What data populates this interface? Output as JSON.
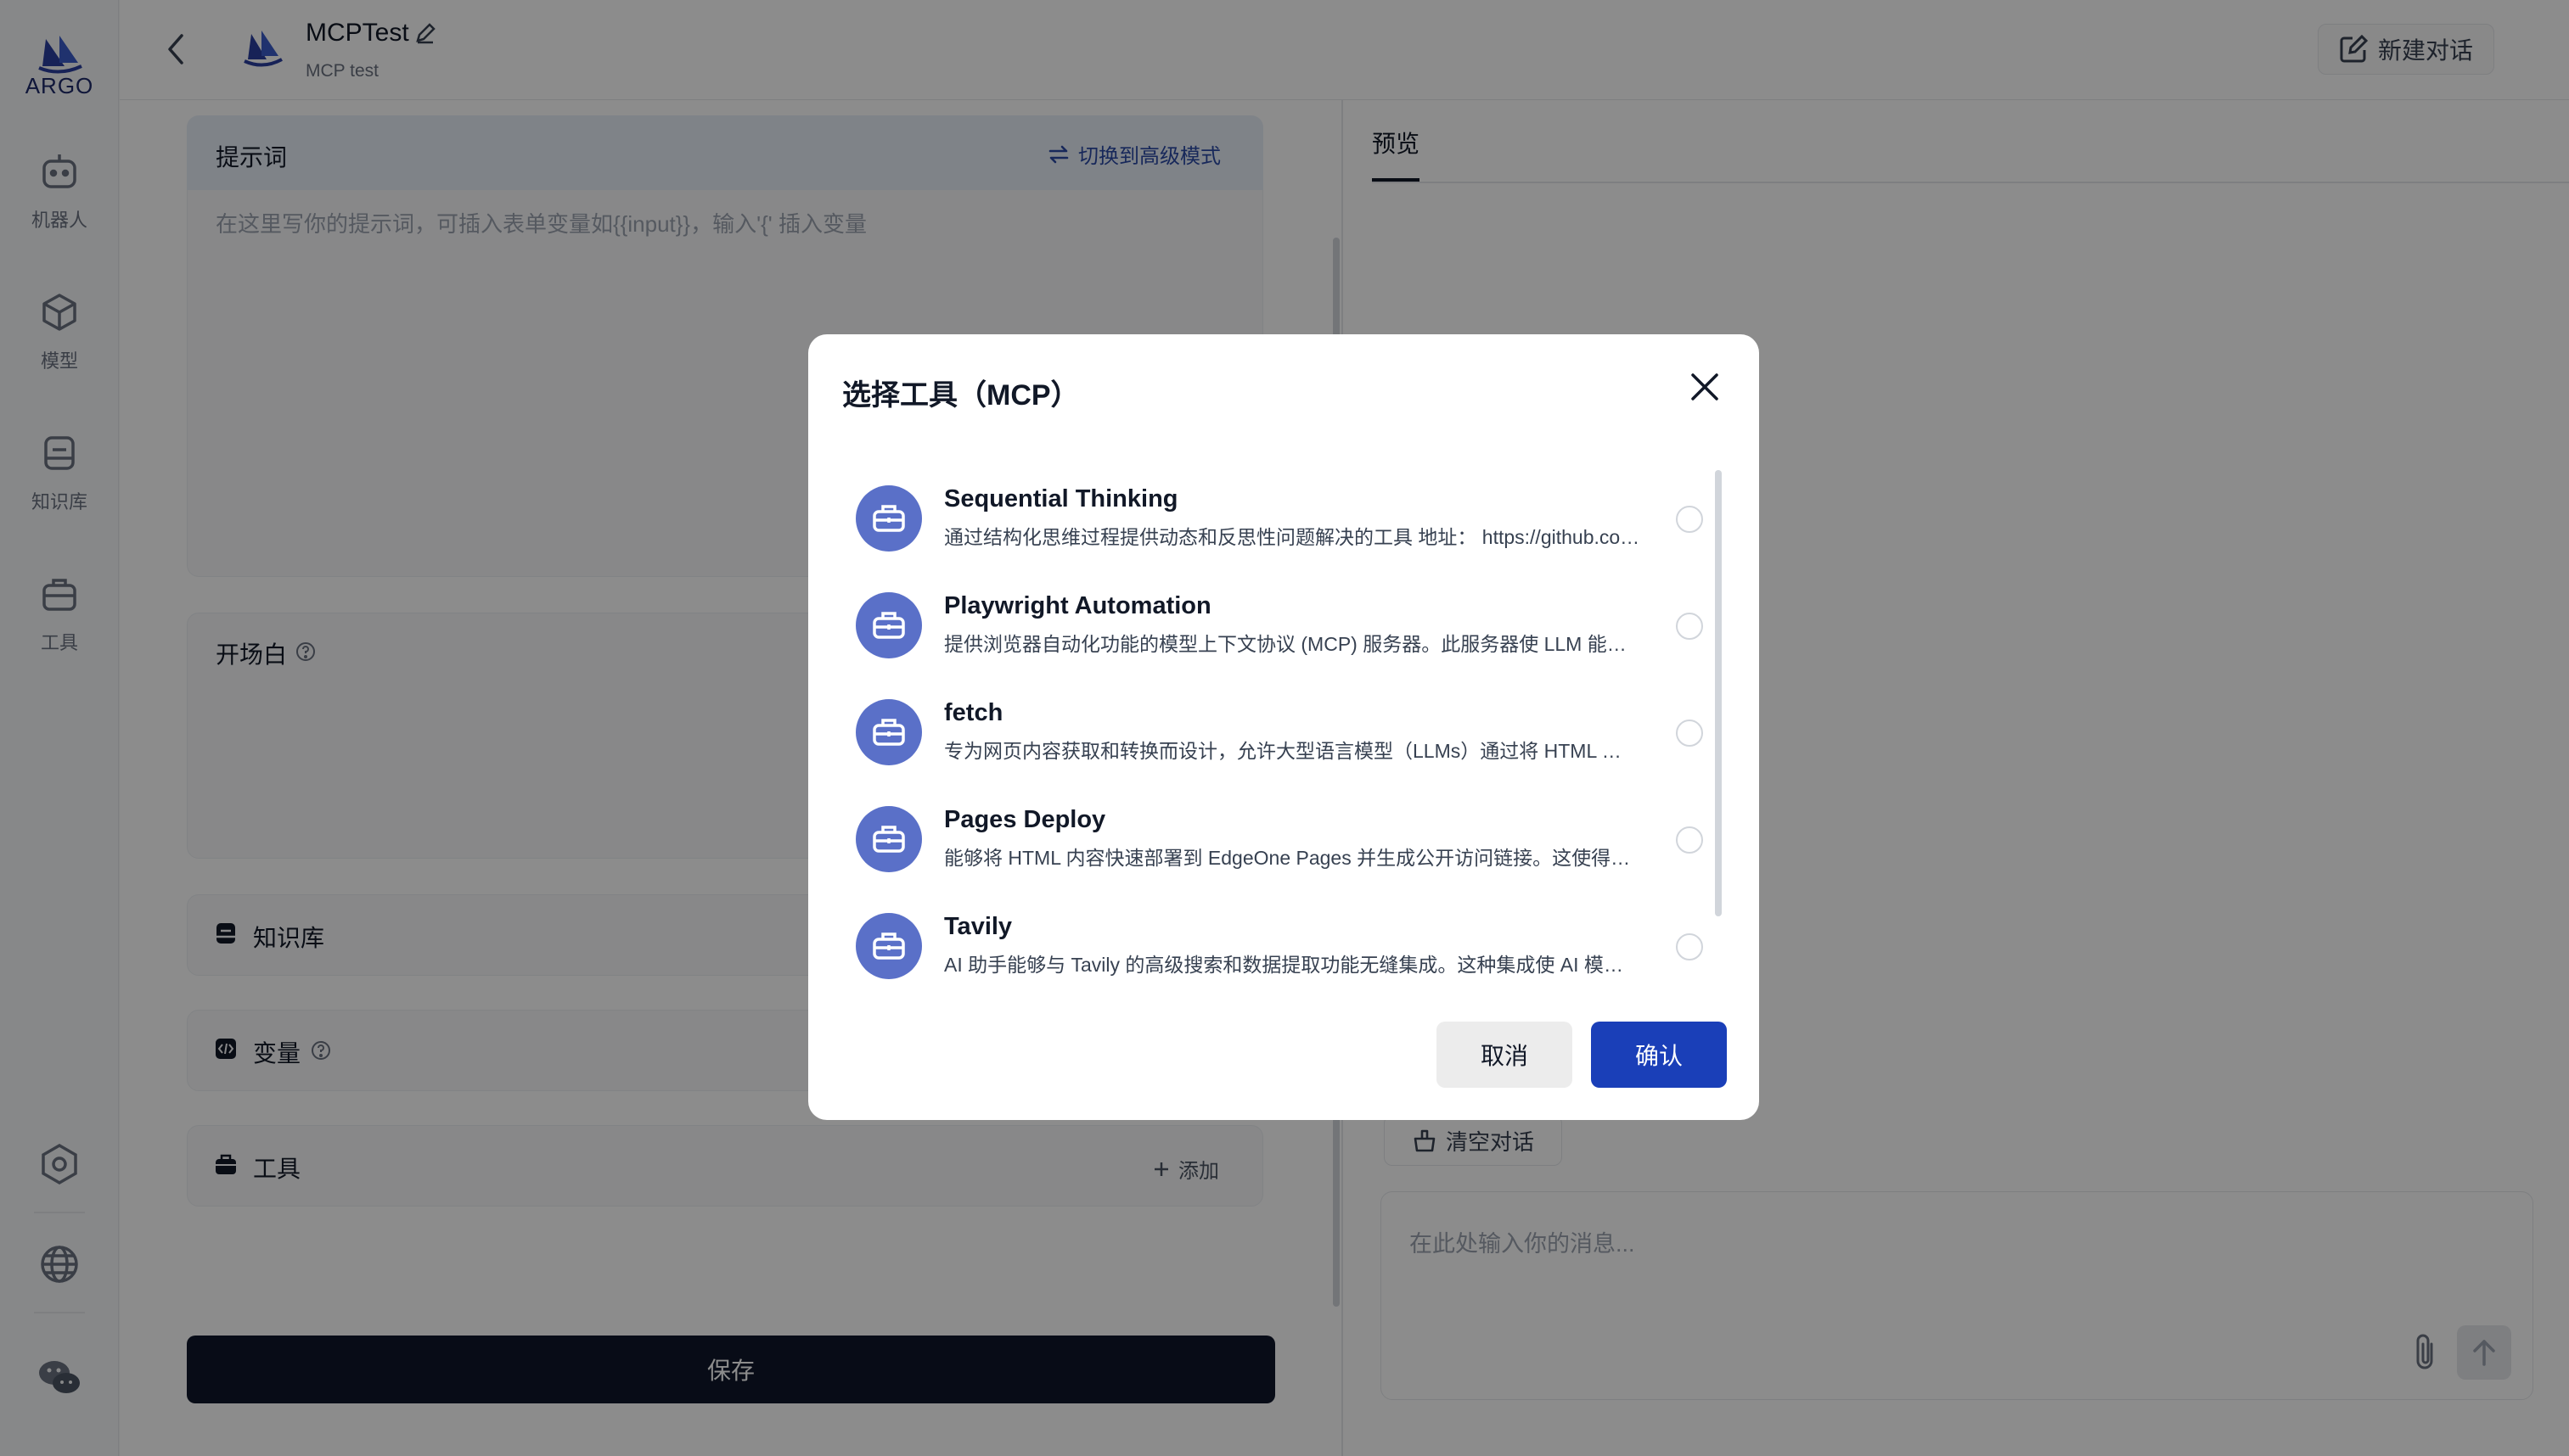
{
  "sidebar": {
    "logo_text": "ARGO",
    "items": [
      {
        "label": "机器人",
        "icon": "robot-icon"
      },
      {
        "label": "模型",
        "icon": "cube-icon"
      },
      {
        "label": "知识库",
        "icon": "database-icon"
      },
      {
        "label": "工具",
        "icon": "toolbox-icon"
      }
    ],
    "bottom_icons": [
      "settings-icon",
      "globe-icon",
      "wechat-icon"
    ]
  },
  "header": {
    "title": "MCPTest",
    "subtitle": "MCP test",
    "new_chat_label": "新建对话"
  },
  "editor": {
    "prompt_label": "提示词",
    "switch_mode_label": "切换到高级模式",
    "prompt_placeholder": "在这里写你的提示词，可插入表单变量如{{input}}，输入'{' 插入变量",
    "opening_label": "开场白",
    "knowledge_label": "知识库",
    "variables_label": "变量",
    "tools_label": "工具",
    "add_label": "添加",
    "save_label": "保存"
  },
  "preview": {
    "tab_label": "预览",
    "clear_label": "清空对话",
    "input_placeholder": "在此处输入你的消息..."
  },
  "modal": {
    "title": "选择工具（MCP）",
    "tools": [
      {
        "name": "Sequential Thinking",
        "desc": "通过结构化思维过程提供动态和反思性问题解决的工具 地址： https://github.com/modelcontextprotocol",
        "selected": false
      },
      {
        "name": "Playwright Automation",
        "desc": "提供浏览器自动化功能的模型上下文协议 (MCP) 服务器。此服务器使 LLM 能够与网页交互",
        "selected": false
      },
      {
        "name": "fetch",
        "desc": "专为网页内容获取和转换而设计，允许大型语言模型（LLMs）通过将 HTML 转换为 Markdown",
        "selected": false
      },
      {
        "name": "Pages Deploy",
        "desc": "能够将 HTML 内容快速部署到 EdgeOne Pages 并生成公开访问链接。这使得内容可以被快速分享",
        "selected": false
      },
      {
        "name": "Tavily",
        "desc": "AI 助手能够与 Tavily 的高级搜索和数据提取功能无缝集成。这种集成使 AI 模型能够实时访问网络",
        "selected": false
      }
    ],
    "cancel_label": "取消",
    "confirm_label": "确认"
  },
  "colors": {
    "accent": "#1a3fb8",
    "tool_icon_bg": "#5a70c8",
    "save_bg": "#0f172a"
  }
}
